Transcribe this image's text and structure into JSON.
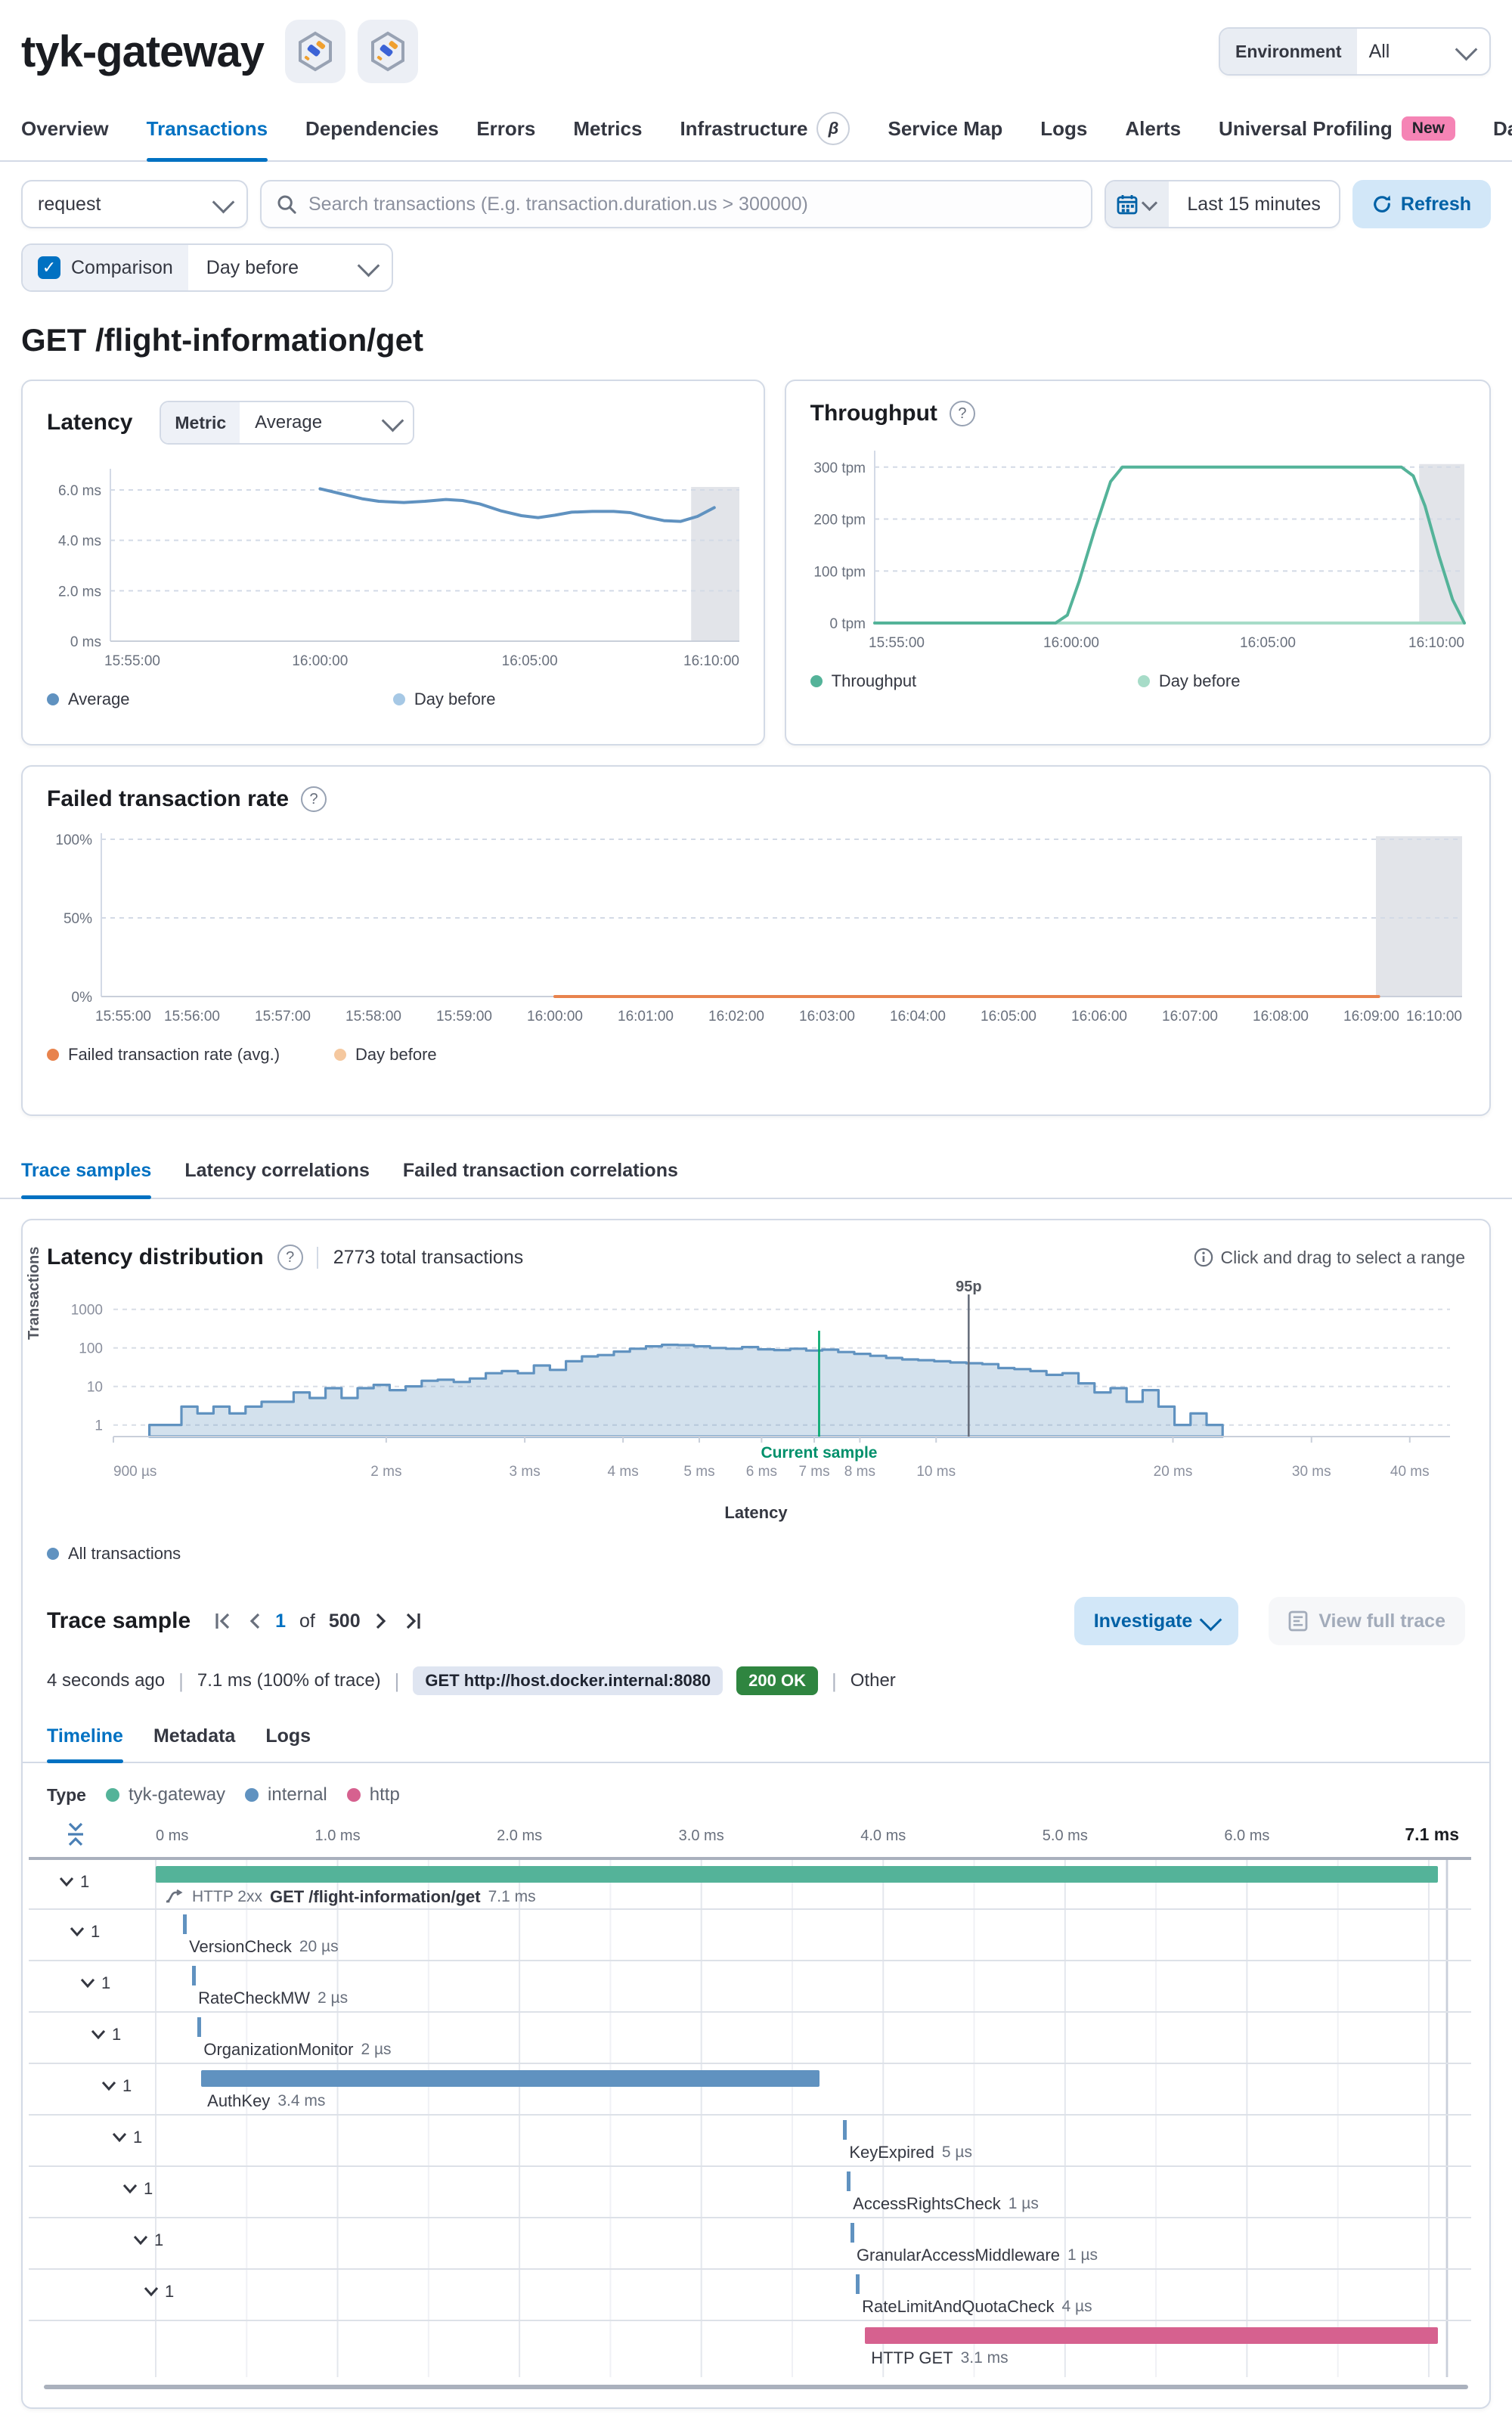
{
  "header": {
    "title": "tyk-gateway",
    "environment_label": "Environment",
    "environment_value": "All"
  },
  "nav_tabs": [
    {
      "label": "Overview"
    },
    {
      "label": "Transactions",
      "active": true
    },
    {
      "label": "Dependencies"
    },
    {
      "label": "Errors"
    },
    {
      "label": "Metrics"
    },
    {
      "label": "Infrastructure",
      "beta": "β"
    },
    {
      "label": "Service Map"
    },
    {
      "label": "Logs"
    },
    {
      "label": "Alerts"
    },
    {
      "label": "Universal Profiling",
      "new": "New"
    },
    {
      "label": "Dashboards",
      "flask": true
    }
  ],
  "filter_bar": {
    "type_value": "request",
    "search_placeholder": "Search transactions (E.g. transaction.duration.us > 300000)",
    "time_range": "Last 15 minutes",
    "refresh_label": "Refresh",
    "comparison_label": "Comparison",
    "comparison_value": "Day before"
  },
  "page_title": "GET /flight-information/get",
  "chart_data": [
    {
      "type": "line",
      "title": "Latency",
      "metric_label": "Metric",
      "metric_value": "Average",
      "ylabel": "ms",
      "ylim": [
        0,
        6.6
      ],
      "yticks": [
        {
          "v": 0,
          "label": "0 ms"
        },
        {
          "v": 2,
          "label": "2.0 ms"
        },
        {
          "v": 4,
          "label": "4.0 ms"
        },
        {
          "v": 6,
          "label": "6.0 ms"
        }
      ],
      "xticks": [
        {
          "t": 0,
          "label": "15:55:00"
        },
        {
          "t": 5,
          "label": "16:00:00"
        },
        {
          "t": 10,
          "label": "16:05:00"
        },
        {
          "t": 15,
          "label": "16:10:00"
        }
      ],
      "band": [
        13.85,
        15
      ],
      "legend": [
        {
          "name": "Average",
          "color": "#6092C0"
        },
        {
          "name": "Day before",
          "color": "#A6C8E5"
        }
      ],
      "series": [
        {
          "name": "Average",
          "color": "#6092C0",
          "points": [
            [
              5,
              6.05
            ],
            [
              5.5,
              5.85
            ],
            [
              6,
              5.65
            ],
            [
              6.4,
              5.55
            ],
            [
              7,
              5.5
            ],
            [
              7.5,
              5.55
            ],
            [
              8,
              5.62
            ],
            [
              8.4,
              5.58
            ],
            [
              8.8,
              5.45
            ],
            [
              9.3,
              5.18
            ],
            [
              9.8,
              4.98
            ],
            [
              10.2,
              4.9
            ],
            [
              10.6,
              5.0
            ],
            [
              11,
              5.12
            ],
            [
              11.5,
              5.15
            ],
            [
              12,
              5.15
            ],
            [
              12.4,
              5.1
            ],
            [
              12.8,
              4.92
            ],
            [
              13.2,
              4.78
            ],
            [
              13.6,
              4.75
            ],
            [
              14,
              4.95
            ],
            [
              14.4,
              5.3
            ]
          ]
        }
      ]
    },
    {
      "type": "line",
      "title": "Throughput",
      "ylabel": "tpm",
      "ylim": [
        0,
        320
      ],
      "yticks": [
        {
          "v": 0,
          "label": "0 tpm"
        },
        {
          "v": 100,
          "label": "100 tpm"
        },
        {
          "v": 200,
          "label": "200 tpm"
        },
        {
          "v": 300,
          "label": "300 tpm"
        }
      ],
      "xticks": [
        {
          "t": 0,
          "label": "15:55:00"
        },
        {
          "t": 5,
          "label": "16:00:00"
        },
        {
          "t": 10,
          "label": "16:05:00"
        },
        {
          "t": 15,
          "label": "16:10:00"
        }
      ],
      "band": [
        13.85,
        15
      ],
      "legend": [
        {
          "name": "Throughput",
          "color": "#54B399"
        },
        {
          "name": "Day before",
          "color": "#A7DCC8"
        }
      ],
      "series": [
        {
          "name": "Day before",
          "color": "#A7DCC8",
          "points": [
            [
              0,
              0
            ],
            [
              15,
              0
            ]
          ]
        },
        {
          "name": "Throughput",
          "color": "#54B399",
          "points": [
            [
              0,
              0
            ],
            [
              4.6,
              0
            ],
            [
              4.9,
              15
            ],
            [
              5.2,
              80
            ],
            [
              5.6,
              180
            ],
            [
              6.0,
              272
            ],
            [
              6.3,
              300
            ],
            [
              13.4,
              300
            ],
            [
              13.7,
              283
            ],
            [
              14.0,
              225
            ],
            [
              14.35,
              130
            ],
            [
              14.7,
              45
            ],
            [
              15,
              0
            ]
          ]
        }
      ]
    },
    {
      "type": "line",
      "title": "Failed transaction rate",
      "ylabel": "%",
      "ylim": [
        0,
        100
      ],
      "yticks": [
        {
          "v": 0,
          "label": "0%"
        },
        {
          "v": 50,
          "label": "50%"
        },
        {
          "v": 100,
          "label": "100%"
        }
      ],
      "xticks": [
        {
          "t": 0,
          "label": "15:55:00"
        },
        {
          "t": 1,
          "label": "15:56:00"
        },
        {
          "t": 2,
          "label": "15:57:00"
        },
        {
          "t": 3,
          "label": "15:58:00"
        },
        {
          "t": 4,
          "label": "15:59:00"
        },
        {
          "t": 5,
          "label": "16:00:00"
        },
        {
          "t": 6,
          "label": "16:01:00"
        },
        {
          "t": 7,
          "label": "16:02:00"
        },
        {
          "t": 8,
          "label": "16:03:00"
        },
        {
          "t": 9,
          "label": "16:04:00"
        },
        {
          "t": 10,
          "label": "16:05:00"
        },
        {
          "t": 11,
          "label": "16:06:00"
        },
        {
          "t": 12,
          "label": "16:07:00"
        },
        {
          "t": 13,
          "label": "16:08:00"
        },
        {
          "t": 14,
          "label": "16:09:00"
        },
        {
          "t": 15,
          "label": "16:10:00"
        }
      ],
      "band": [
        14.05,
        15
      ],
      "legend": [
        {
          "name": "Failed transaction rate (avg.)",
          "color": "#E8834D"
        },
        {
          "name": "Day before",
          "color": "#F5C89F"
        }
      ],
      "series": [
        {
          "name": "Failed transaction rate (avg.)",
          "color": "#E8834D",
          "points": [
            [
              5,
              0
            ],
            [
              14.08,
              0
            ]
          ]
        }
      ]
    },
    {
      "type": "histogram",
      "title": "Latency distribution",
      "xlabel": "Latency",
      "ylabel": "Transactions",
      "x_start_ms": 1.0,
      "x_ratio": 1.048,
      "counts": [
        1,
        1,
        3,
        2,
        3,
        2,
        3,
        4,
        4,
        7,
        5,
        9,
        5,
        9,
        11,
        8,
        10,
        14,
        15,
        13,
        16,
        22,
        25,
        22,
        35,
        27,
        45,
        60,
        65,
        80,
        95,
        110,
        120,
        118,
        110,
        100,
        95,
        105,
        92,
        88,
        95,
        85,
        90,
        78,
        70,
        62,
        55,
        50,
        48,
        45,
        42,
        40,
        38,
        30,
        28,
        25,
        20,
        22,
        12,
        7,
        9,
        4,
        8,
        3,
        1,
        2,
        1
      ],
      "current_sample_ms": 7.1,
      "p95_ms": 11,
      "fill": "#CFE0EF",
      "stroke": "#6092C0",
      "yticks": [
        1,
        10,
        100,
        1000
      ],
      "xticks": [
        {
          "v": 0.9,
          "label": "900 µs"
        },
        {
          "v": 2,
          "label": "2 ms"
        },
        {
          "v": 3,
          "label": "3 ms"
        },
        {
          "v": 4,
          "label": "4 ms"
        },
        {
          "v": 5,
          "label": "5 ms"
        },
        {
          "v": 6,
          "label": "6 ms"
        },
        {
          "v": 7,
          "label": "7 ms"
        },
        {
          "v": 8,
          "label": "8 ms"
        },
        {
          "v": 10,
          "label": "10 ms"
        },
        {
          "v": 20,
          "label": "20 ms"
        },
        {
          "v": 30,
          "label": "30 ms"
        },
        {
          "v": 40,
          "label": "40 ms"
        }
      ]
    }
  ],
  "correlation_tabs": [
    {
      "label": "Trace samples",
      "active": true
    },
    {
      "label": "Latency correlations"
    },
    {
      "label": "Failed transaction correlations"
    }
  ],
  "latency_distribution": {
    "title": "Latency distribution",
    "total_label": "2773 total transactions",
    "hint": "Click and drag to select a range",
    "current_sample_label": "Current sample",
    "p95_label": "95p",
    "legend": "All transactions",
    "legend_color": "#6092C0",
    "xlabel": "Latency",
    "ylabel": "Transactions"
  },
  "trace_sample": {
    "title": "Trace sample",
    "page": "1",
    "of_label": "of",
    "total": "500",
    "investigate_label": "Investigate",
    "view_full_trace_label": "View full trace",
    "age": "4 seconds ago",
    "duration": "7.1 ms (100% of trace)",
    "url_badge": "GET http://host.docker.internal:8080",
    "status_badge": "200 OK",
    "other_label": "Other",
    "tabs": [
      {
        "label": "Timeline",
        "active": true
      },
      {
        "label": "Metadata"
      },
      {
        "label": "Logs"
      }
    ],
    "type_label": "Type",
    "types": [
      {
        "label": "tyk-gateway",
        "color": "#54B399"
      },
      {
        "label": "internal",
        "color": "#6092C0"
      },
      {
        "label": "http",
        "color": "#D6618F"
      }
    ]
  },
  "waterfall": {
    "ruler": [
      {
        "ms": 0,
        "label": "0 ms"
      },
      {
        "ms": 1,
        "label": "1.0 ms"
      },
      {
        "ms": 2,
        "label": "2.0 ms"
      },
      {
        "ms": 3,
        "label": "3.0 ms"
      },
      {
        "ms": 4,
        "label": "4.0 ms"
      },
      {
        "ms": 5,
        "label": "5.0 ms"
      },
      {
        "ms": 6,
        "label": "6.0 ms"
      }
    ],
    "total_label": "7.1 ms",
    "duration_ms": 7.1,
    "rows": [
      {
        "badge": "HTTP 2xx",
        "name": "GET /flight-information/get",
        "duration": "7.1 ms",
        "start": 0,
        "dur": 7.05,
        "type": "bar",
        "color": "#54B399",
        "indent": 0,
        "chevron": true,
        "icon": true
      },
      {
        "name": "VersionCheck",
        "duration": "20 µs",
        "start": 0.15,
        "type": "tick",
        "color": "#6092C0",
        "indent": 1,
        "chevron": true
      },
      {
        "name": "RateCheckMW",
        "duration": "2 µs",
        "start": 0.2,
        "type": "tick",
        "color": "#6092C0",
        "indent": 2,
        "chevron": true
      },
      {
        "name": "OrganizationMonitor",
        "duration": "2 µs",
        "start": 0.23,
        "type": "tick",
        "color": "#6092C0",
        "indent": 3,
        "chevron": true
      },
      {
        "name": "AuthKey",
        "duration": "3.4 ms",
        "start": 0.25,
        "dur": 3.4,
        "type": "bar",
        "color": "#6092C0",
        "indent": 4,
        "chevron": true
      },
      {
        "name": "KeyExpired",
        "duration": "5 µs",
        "start": 3.78,
        "type": "tick",
        "color": "#6092C0",
        "indent": 5,
        "chevron": true
      },
      {
        "name": "AccessRightsCheck",
        "duration": "1 µs",
        "start": 3.8,
        "type": "tick",
        "color": "#6092C0",
        "indent": 6,
        "chevron": true
      },
      {
        "name": "GranularAccessMiddleware",
        "duration": "1 µs",
        "start": 3.82,
        "type": "tick",
        "color": "#6092C0",
        "indent": 7,
        "chevron": true
      },
      {
        "name": "RateLimitAndQuotaCheck",
        "duration": "4 µs",
        "start": 3.85,
        "type": "tick",
        "color": "#6092C0",
        "indent": 8,
        "chevron": true
      },
      {
        "name": "HTTP GET",
        "duration": "3.1 ms",
        "start": 3.9,
        "dur": 3.15,
        "type": "bar",
        "color": "#D6618F",
        "indent": 9,
        "chevron": false
      }
    ]
  }
}
